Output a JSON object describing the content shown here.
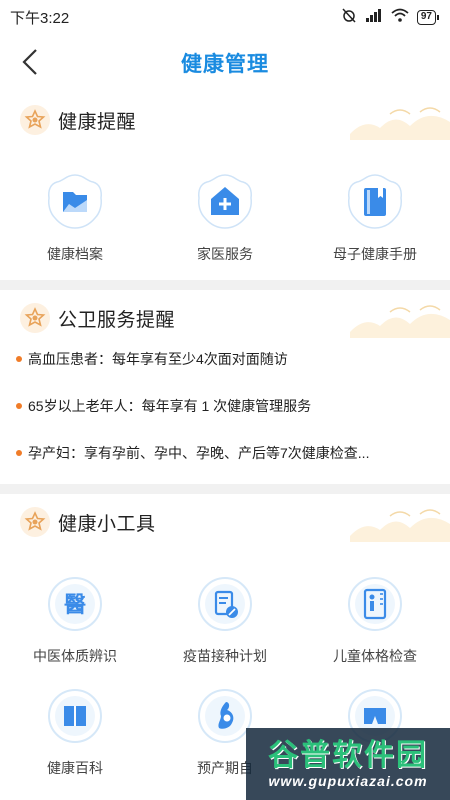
{
  "status_bar": {
    "time": "下午3:22",
    "battery": "97"
  },
  "header": {
    "title": "健康管理"
  },
  "sections": {
    "health_reminder": {
      "title": "健康提醒",
      "items": [
        {
          "label": "健康档案",
          "icon": "folder-icon"
        },
        {
          "label": "家医服务",
          "icon": "home-plus-icon"
        },
        {
          "label": "母子健康手册",
          "icon": "book-icon"
        }
      ]
    },
    "public_service": {
      "title": "公卫服务提醒",
      "notices": [
        "高血压患者：每年享有至少4次面对面随访",
        "65岁以上老年人：每年享有 1 次健康管理服务",
        "孕产妇：享有孕前、孕中、孕晚、产后等7次健康检查..."
      ]
    },
    "health_tools": {
      "title": "健康小工具",
      "items": [
        {
          "label": "中医体质辨识",
          "icon": "tcm-icon"
        },
        {
          "label": "疫苗接种计划",
          "icon": "vaccine-record-icon"
        },
        {
          "label": "儿童体格检查",
          "icon": "child-growth-icon"
        },
        {
          "label": "健康百科",
          "icon": "encyclopedia-icon"
        },
        {
          "label": "预产期自",
          "icon": "pregnancy-icon"
        },
        {
          "label": "",
          "icon": "shorts-icon"
        }
      ]
    }
  },
  "watermark": {
    "main": "谷普软件园",
    "url": "www.gupuxiazai.com"
  },
  "colors": {
    "accent": "#1a8be0",
    "notice_dot": "#f07c28",
    "section_icon": "#e8a35a"
  }
}
